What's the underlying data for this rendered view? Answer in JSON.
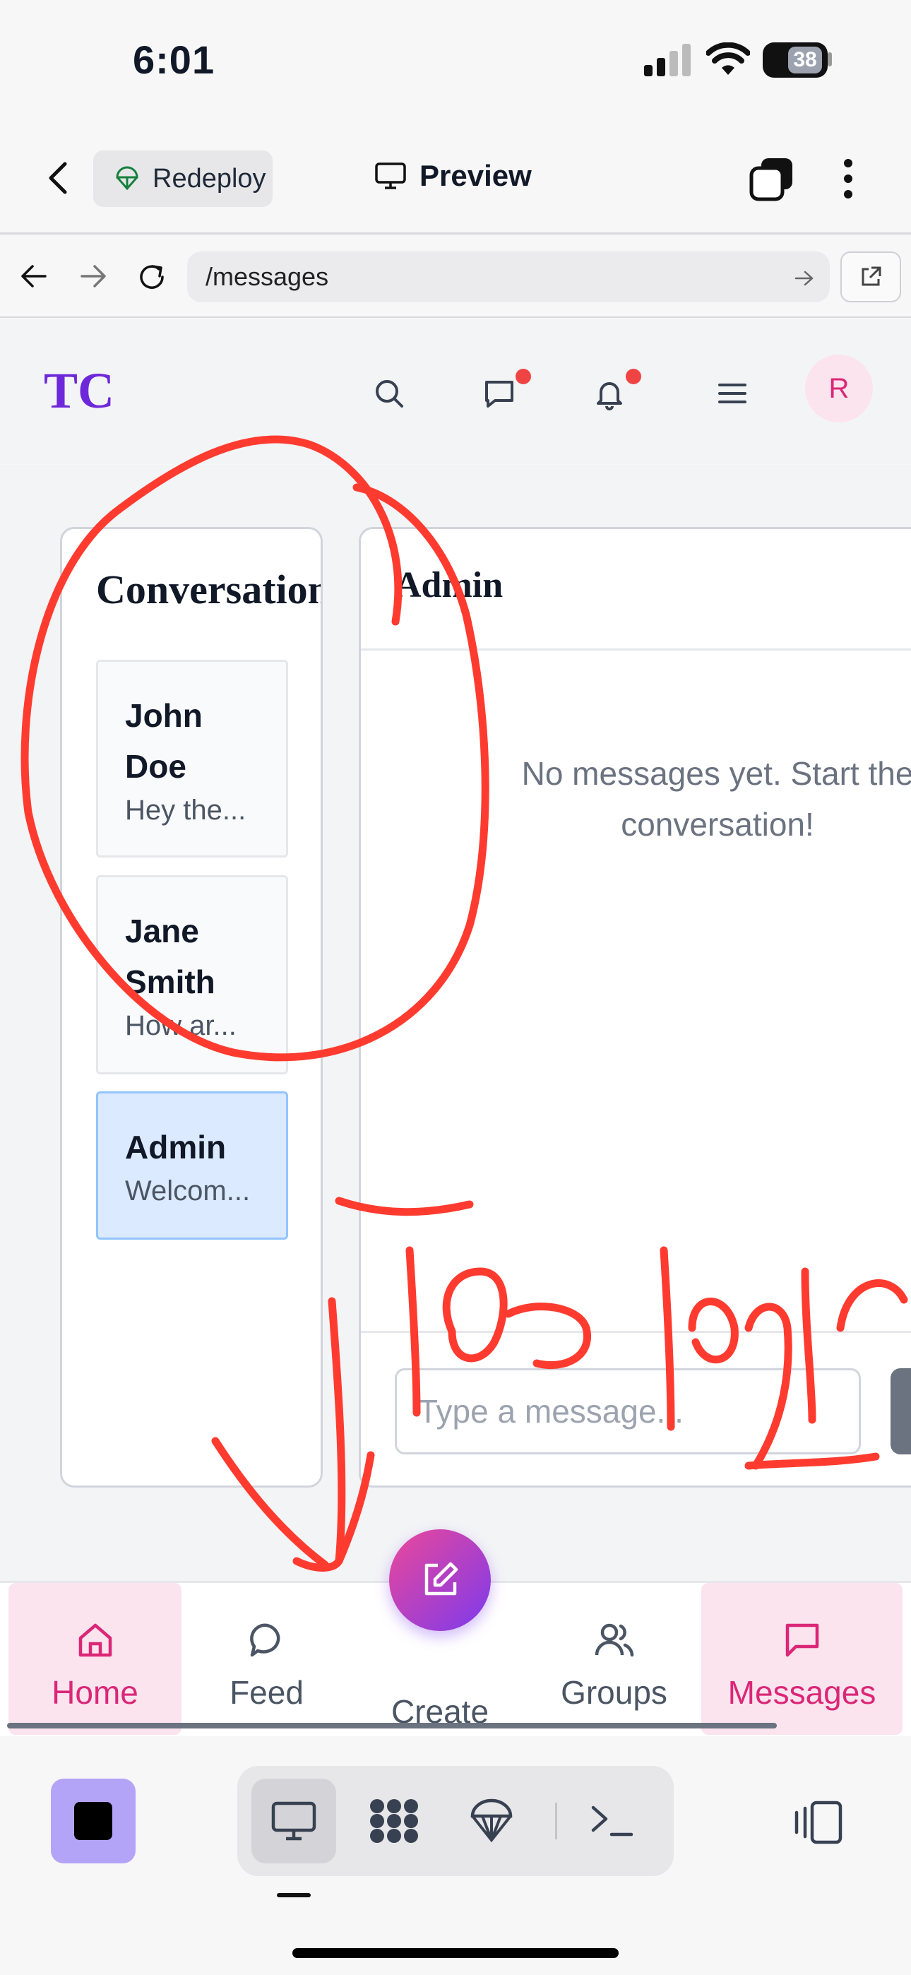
{
  "status_bar": {
    "time": "6:01",
    "battery": "38"
  },
  "app_header": {
    "redeploy_label": "Redeploy",
    "preview_label": "Preview"
  },
  "browser": {
    "url": "/messages"
  },
  "site": {
    "logo": "TC",
    "avatar_initial": "R"
  },
  "conversations": {
    "title": "Conversation",
    "items": [
      {
        "name_line1": "John",
        "name_line2": "Doe",
        "preview": "Hey the..."
      },
      {
        "name_line1": "Jane",
        "name_line2": "Smith",
        "preview": "How ar..."
      },
      {
        "name_line1": "Admin",
        "preview": "Welcom..."
      }
    ]
  },
  "chat": {
    "title": "Admin",
    "empty_line1": "No messages yet. Start the",
    "empty_line2": "conversation!",
    "input_placeholder": "Type a message..."
  },
  "bottom_nav": {
    "home": "Home",
    "feed": "Feed",
    "create": "Create",
    "groups": "Groups",
    "messages": "Messages"
  },
  "annotation": {
    "handwritten_text": "Too large",
    "color": "#ff3b30"
  },
  "colors": {
    "accent_pink": "#db2777",
    "accent_purple": "#7c3aed",
    "active_conv": "#dbeafe"
  }
}
